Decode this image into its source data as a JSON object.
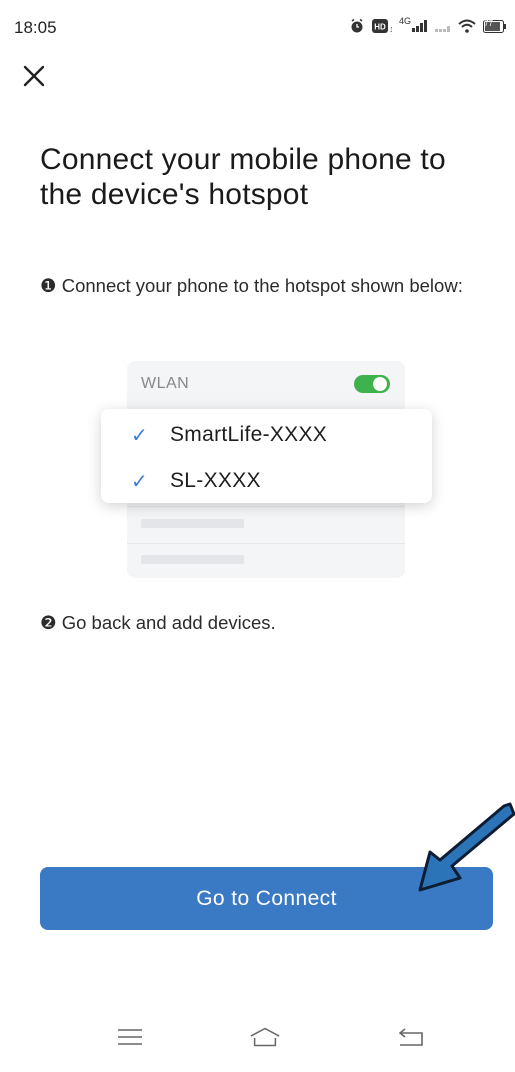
{
  "status_bar": {
    "time": "18:05",
    "network": "4G",
    "battery": "77"
  },
  "page": {
    "title": "Connect your mobile phone to the device's hotspot",
    "step1_number": "❶",
    "step1_text": "Connect your phone to the hotspot shown below:",
    "step2_number": "❷",
    "step2_text": "Go back and add devices."
  },
  "illustration": {
    "wlan_label": "WLAN",
    "wlan_enabled": true,
    "networks": [
      {
        "name": "SmartLife-XXXX",
        "checked": true
      },
      {
        "name": "SL-XXXX",
        "checked": true
      }
    ]
  },
  "actions": {
    "connect_label": "Go to Connect"
  },
  "colors": {
    "accent": "#3a79c4",
    "toggle_on": "#3db24e",
    "check": "#3e7fd6",
    "annotation_arrow": "#2c74b8"
  },
  "icons": {
    "close": "close-icon",
    "nav_menu": "menu-icon",
    "nav_home": "home-icon",
    "nav_back": "back-icon"
  }
}
